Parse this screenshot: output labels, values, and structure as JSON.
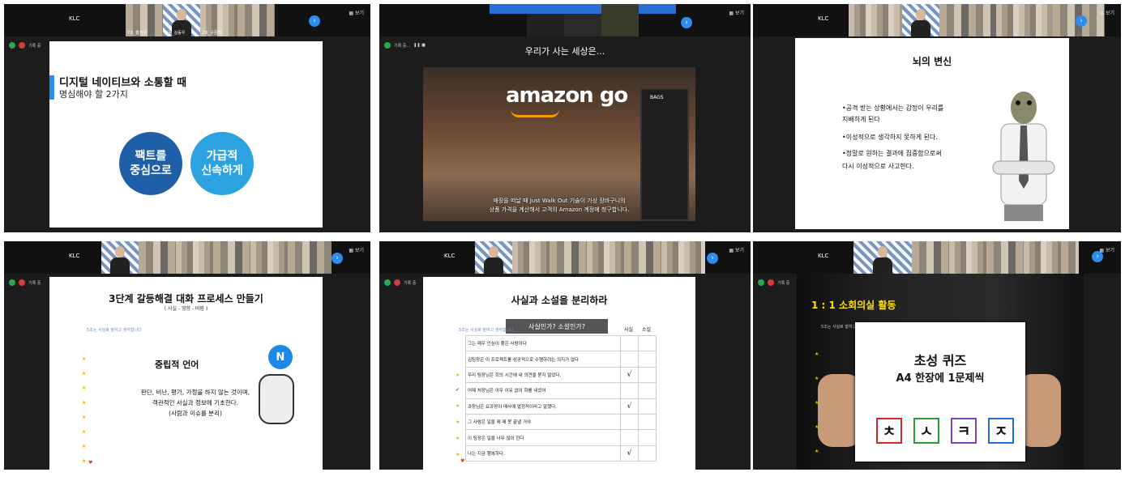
{
  "panel1": {
    "header": {
      "app": "KLC",
      "view_label": "▦ 보기"
    },
    "thumbs": [
      "7조_황진성",
      "조윤_김동우",
      "2조_구준혁"
    ],
    "status": "기록 중",
    "slide": {
      "title": "디지털 네이티브와 소통할 때",
      "subtitle": "명심해야 할 2가지",
      "circle_left": "팩트를\n중심으로",
      "circle_right": "가급적\n신속하게"
    }
  },
  "panel2": {
    "header": {
      "view_label": "▦ 보기"
    },
    "status": "기록 중...",
    "slide": {
      "title": "우리가 사는 세상은...",
      "brand": "amazon go",
      "bags": "BAGS",
      "subtitle_line1": "매장을 떠날 때 Just Walk Out 기술이 가상 장바구니의",
      "subtitle_line2": "상품 가격을 계산해서 고객의 Amazon 계정에 청구합니다."
    }
  },
  "panel3": {
    "header": {
      "app": "KLC",
      "view_label": "▦ 보기"
    },
    "slide": {
      "title": "뇌의 변신",
      "bullets": [
        "•공격 받는 상황에서는 감정이 우리를",
        "  지배하게 된다",
        "•이성적으로 생각하지 못하게 된다.",
        "•정말로 원하는 결과에 집중함으로써",
        "  다시 이성적으로 사고한다."
      ]
    }
  },
  "panel4": {
    "header": {
      "app": "KLC",
      "view_label": "▦ 보기"
    },
    "status": "기록 중",
    "slide": {
      "title": "3단계 갈등해결 대화 프로세스 만들기",
      "subtitle": "( 사실 - 영향 - 바람 )",
      "note": "5조는 사실로 말하고 생각합니다",
      "heading": "중립적 언어",
      "body_line1": "판단, 비난, 평가, 가정을 하지 않는 것이며,",
      "body_line2": "객관적인 사실과 정보에 기초한다.",
      "body_line3": "(사람과 이슈를 분리)",
      "badge": "N"
    }
  },
  "panel5": {
    "header": {
      "app": "KLC",
      "view_label": "▦ 보기"
    },
    "status": "기록 중",
    "slide": {
      "title": "사실과 소설을 분리하라",
      "question": "사실인가?  소설인가?",
      "col_fact": "사실",
      "col_novel": "소설",
      "note": "5조는 사실로 말하고 생각합니다",
      "rows": [
        {
          "text": "그는 매우 인심이 좋은 사람이다",
          "fact": "",
          "novel": ""
        },
        {
          "text": "김팀장은 이 프로젝트를 성공적으로 수행하려는 의지가 없다",
          "fact": "",
          "novel": ""
        },
        {
          "text": "우리 팀장님은 회의 시간에 내 의견을 묻지 않았다.",
          "fact": "√",
          "novel": ""
        },
        {
          "text": "어제 처장님은 아무 이유 없이 화를 내셨어",
          "fact": "",
          "novel": ""
        },
        {
          "text": "과장님은 요과장이 매사에 열정적이라고 말했다.",
          "fact": "√",
          "novel": ""
        },
        {
          "text": "그 사람은 일을 제 때 못 끝낼 거야",
          "fact": "",
          "novel": ""
        },
        {
          "text": "이 팀장은 일을 너무 많이 한다",
          "fact": "",
          "novel": ""
        },
        {
          "text": "나는 지금 행복하다.",
          "fact": "√",
          "novel": ""
        }
      ]
    }
  },
  "panel6": {
    "header": {
      "app": "KLC",
      "view_label": "▦ 보기"
    },
    "status": "기록 중",
    "slide": {
      "title": "1 : 1 소회의실 활동",
      "note": "5조는 사실로 말하고 생각합니다",
      "heading1": "초성 퀴즈",
      "heading2": "A4 한장에 1문제씩",
      "chosung": [
        "ㅊ",
        "ㅅ",
        "ㅋ",
        "ㅈ"
      ],
      "chosung_colors": [
        "#d62828",
        "#2a9d3a",
        "#7b3fbf",
        "#1f6fd6"
      ]
    }
  }
}
